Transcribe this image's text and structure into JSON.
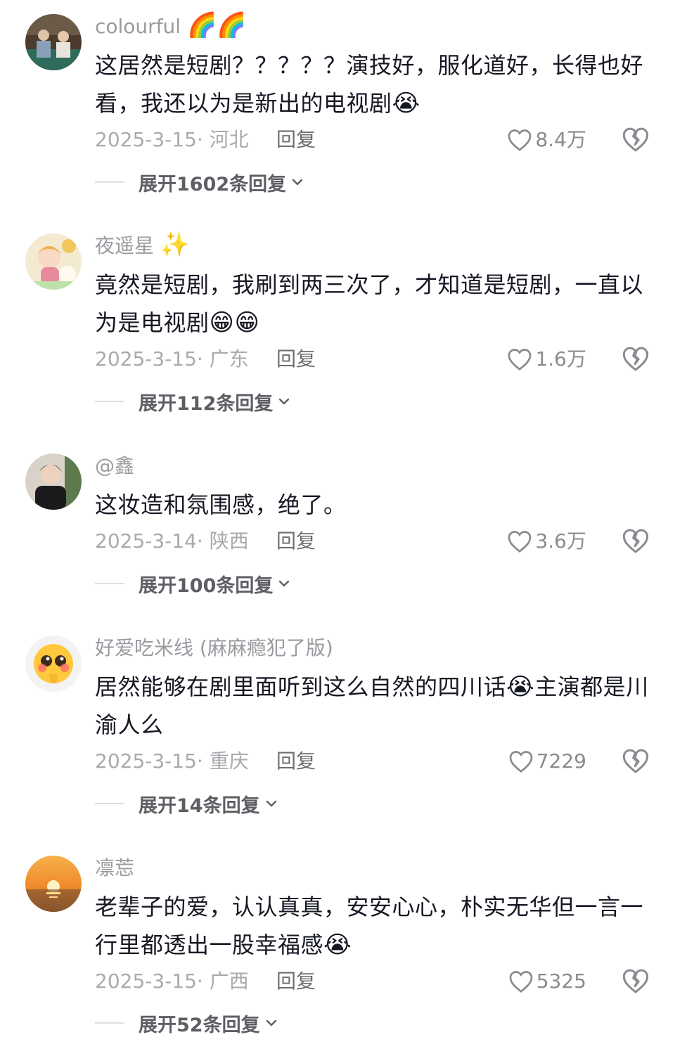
{
  "comments": [
    {
      "username": "colourful",
      "username_emoji": "🌈🌈",
      "text": "这居然是短剧？？？？？演技好，服化道好，长得也好看，我还以为是新出的电视剧",
      "text_emoji": "😭",
      "date_location": "2025-3-15· 河北",
      "reply_label": "回复",
      "likes": "8.4万",
      "expand_label": "展开1602条回复",
      "avatar_icon": "two-men-sitting-avatar"
    },
    {
      "username": "夜遥星",
      "username_emoji": "✨",
      "text": "竟然是短剧，我刷到两三次了，才知道是短剧，一直以为是电视剧",
      "text_emoji": "😁😁",
      "date_location": "2025-3-15· 广东",
      "reply_label": "回复",
      "likes": "1.6万",
      "expand_label": "展开112条回复",
      "avatar_icon": "anime-girl-avatar"
    },
    {
      "username": "@鑫",
      "username_emoji": "",
      "text": "这妆造和氛围感，绝了。",
      "text_emoji": "",
      "date_location": "2025-3-14· 陕西",
      "reply_label": "回复",
      "likes": "3.6万",
      "expand_label": "展开100条回复",
      "avatar_icon": "young-man-avatar"
    },
    {
      "username": "好爱吃米线 (麻麻瘾犯了版)",
      "username_emoji": "",
      "text": "居然能够在剧里面听到这么自然的四川话",
      "text_emoji": "😭",
      "text_after": "主演都是川渝人么",
      "date_location": "2025-3-15· 重庆",
      "reply_label": "回复",
      "likes": "7229",
      "expand_label": "展开14条回复",
      "avatar_icon": "pleading-face-avatar"
    },
    {
      "username": "凛莣",
      "username_emoji": "",
      "text": "老辈子的爱，认认真真，安安心心，朴实无华但一言一行里都透出一股幸福感",
      "text_emoji": "😭",
      "date_location": "2025-3-15· 广西",
      "reply_label": "回复",
      "likes": "5325",
      "expand_label": "展开52条回复",
      "avatar_icon": "sunset-sea-avatar"
    }
  ],
  "colors": {
    "text": "#161823",
    "meta": "#a9aaaf",
    "username": "#9a9ba0",
    "expand": "#5e5f64"
  }
}
